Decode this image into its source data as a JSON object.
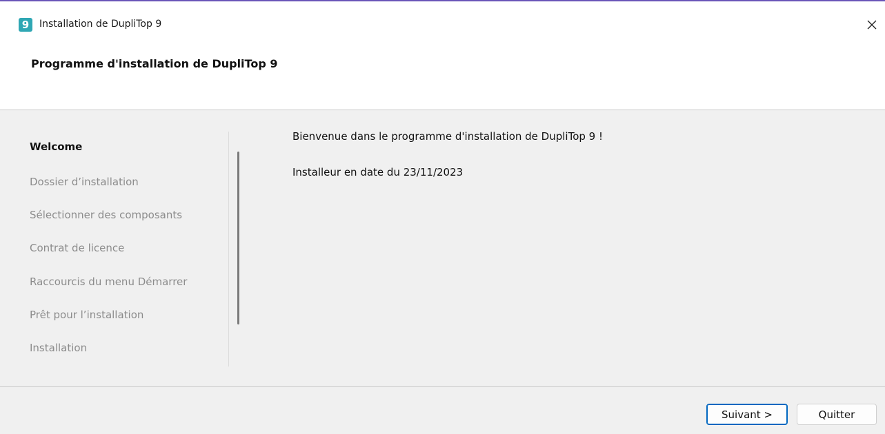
{
  "window": {
    "title": "Installation de DupliTop 9",
    "icon_glyph": "9",
    "icon_color": "#2fa7b4",
    "close_icon": "close-icon"
  },
  "header": {
    "title": "Programme d'installation de DupliTop 9"
  },
  "steps": [
    {
      "label": "Welcome",
      "active": true
    },
    {
      "label": "Dossier d’installation",
      "active": false
    },
    {
      "label": "Sélectionner des composants",
      "active": false
    },
    {
      "label": "Contrat de licence",
      "active": false
    },
    {
      "label": "Raccourcis du menu Démarrer",
      "active": false
    },
    {
      "label": "Prêt pour l’installation",
      "active": false
    },
    {
      "label": "Installation",
      "active": false
    }
  ],
  "content": {
    "welcome": "Bienvenue dans le programme d'installation de DupliTop 9 !",
    "date_line": "Installeur en date du 23/11/2023"
  },
  "footer": {
    "next_label": "Suivant >",
    "quit_label": "Quitter"
  },
  "colors": {
    "accent_strip": "#6a55b8",
    "default_button_border": "#0067c0",
    "panel_background": "#f0f0f0",
    "inactive_step_text": "#8c8c8c"
  }
}
